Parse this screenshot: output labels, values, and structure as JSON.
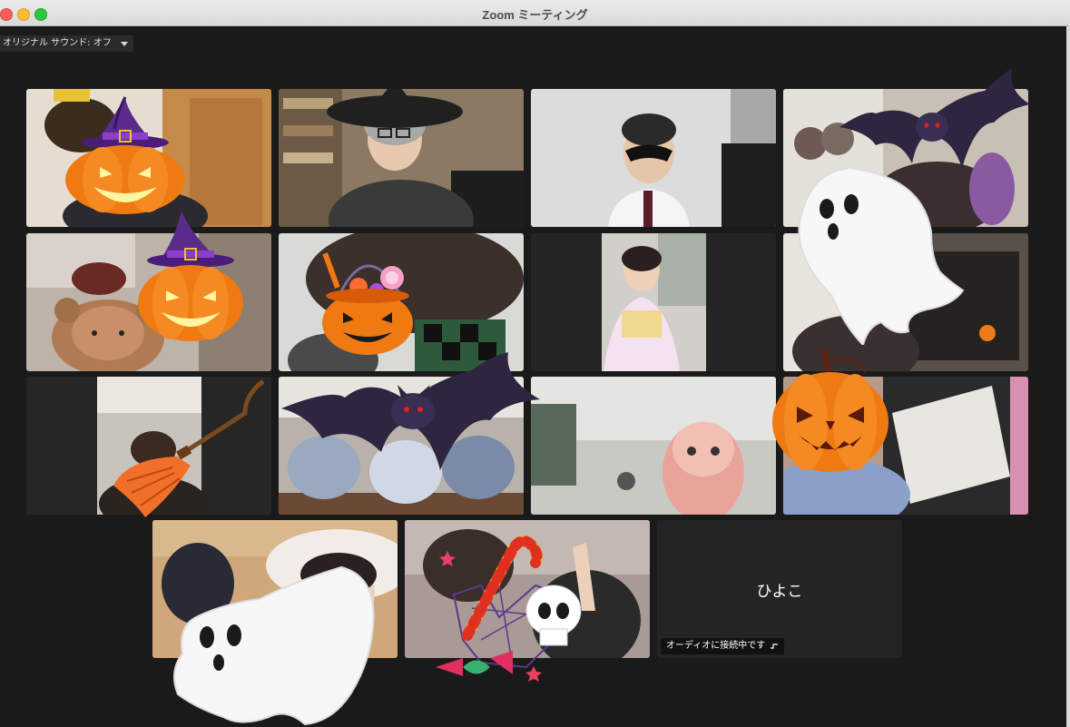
{
  "window": {
    "title": "Zoom ミーティング"
  },
  "audio_toggle": {
    "label": "オリジナル サウンド: オフ"
  },
  "gallery": {
    "participants": [
      {
        "id": 1
      },
      {
        "id": 2
      },
      {
        "id": 3
      },
      {
        "id": 4
      },
      {
        "id": 5
      },
      {
        "id": 6
      },
      {
        "id": 7
      },
      {
        "id": 8
      },
      {
        "id": 9
      },
      {
        "id": 10
      },
      {
        "id": 11
      },
      {
        "id": 12
      },
      {
        "id": 13,
        "active_speaker": true
      },
      {
        "id": 14
      },
      {
        "id": 15,
        "name": "ひよこ",
        "status": "オーディオに接続中です"
      }
    ]
  },
  "decorations": [
    "witch-hat-pumpkin",
    "witch-hat-pumpkin",
    "candy-pumpkin-basket",
    "bat",
    "ghost",
    "pumpkin",
    "broom",
    "bat",
    "ghost",
    "candy-cane",
    "skull",
    "spider-web",
    "wrapped-candy"
  ],
  "colors": {
    "active_speaker_border": "#23d959",
    "pumpkin": "#f07a12",
    "bat": "#2e2540"
  }
}
